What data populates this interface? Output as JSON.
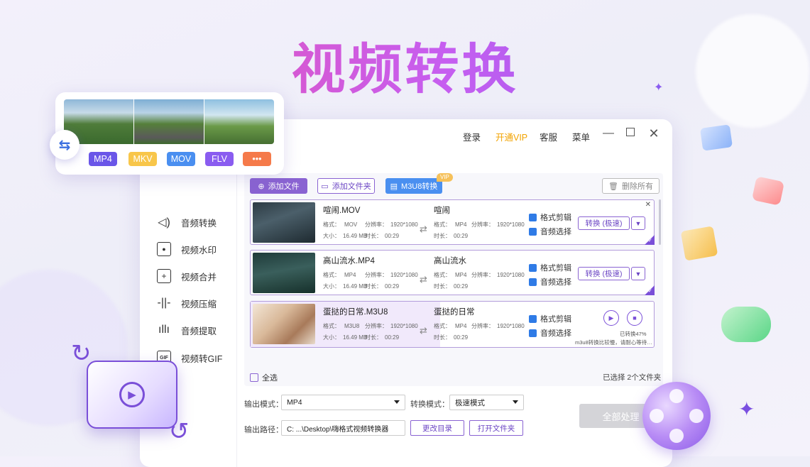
{
  "hero": {
    "title": "视频转换"
  },
  "topbar": {
    "login": "登录",
    "vip": "开通VIP",
    "service": "客服",
    "menu": "菜单"
  },
  "sidebar": {
    "items": [
      {
        "label": "音频转换",
        "icon": "speaker-icon"
      },
      {
        "label": "视频水印",
        "icon": "watermark-icon"
      },
      {
        "label": "视频合并",
        "icon": "merge-icon"
      },
      {
        "label": "视频压缩",
        "icon": "compress-icon"
      },
      {
        "label": "音频提取",
        "icon": "waveform-icon"
      },
      {
        "label": "视频转GIF",
        "icon": "gif-icon"
      }
    ]
  },
  "toolbar": {
    "add_file": "添加文件",
    "add_folder": "添加文件夹",
    "m3u8": "M3U8转换",
    "vip_badge": "VIP",
    "delete_all": "删除所有"
  },
  "files": [
    {
      "src_name": "喧闹.MOV",
      "dst_name": "喧闹",
      "src_format_label": "格式：",
      "src_format": "MOV",
      "src_res_label": "分辨率：",
      "src_res": "1920*1080",
      "src_size_label": "大小：",
      "src_size": "16.49 MB",
      "src_dur_label": "时长：",
      "src_dur": "00:29",
      "dst_format": "MP4",
      "dst_res": "1920*1080",
      "dst_dur": "00:29",
      "edit": "格式剪辑",
      "audio": "音频选择",
      "convert": "转换 (极速)"
    },
    {
      "src_name": "高山流水.MP4",
      "dst_name": "高山流水",
      "src_format_label": "格式：",
      "src_format": "MP4",
      "src_res_label": "分辨率：",
      "src_res": "1920*1080",
      "src_size_label": "大小：",
      "src_size": "16.49 MB",
      "src_dur_label": "时长：",
      "src_dur": "00:29",
      "dst_format": "MP4",
      "dst_res": "1920*1080",
      "dst_dur": "00:29",
      "edit": "格式剪辑",
      "audio": "音频选择",
      "convert": "转换 (极速)"
    },
    {
      "src_name": "蛋挞的日常.M3U8",
      "dst_name": "蛋挞的日常",
      "src_format_label": "格式：",
      "src_format": "M3U8",
      "src_res_label": "分辨率：",
      "src_res": "1920*1080",
      "src_size_label": "大小：",
      "src_size": "16.49 MB",
      "src_dur_label": "时长：",
      "src_dur": "00:29",
      "dst_format": "MP4",
      "dst_res": "1920*1080",
      "dst_dur": "00:29",
      "edit": "格式剪辑",
      "audio": "音频选择",
      "progress_text": "已转换47%",
      "progress": 0.47,
      "hint": "m3u8转换比较慢，请耐心等待…"
    }
  ],
  "footer": {
    "select_all": "全选",
    "selected": "已选择 2个文件夹",
    "output_mode_label": "输出模式：",
    "output_mode": "MP4",
    "convert_mode_label": "转换模式：",
    "convert_mode": "极速模式",
    "output_path_label": "输出路径：",
    "output_path": "C: ...\\Desktop\\嗨格式视频转换器",
    "change_dir": "更改目录",
    "open_folder": "打开文件夹",
    "process_all": "全部处理"
  },
  "formats": [
    "MP4",
    "MKV",
    "MOV",
    "FLV",
    "•••"
  ],
  "format_colors": [
    "#6a56e8",
    "#f8c64a",
    "#4a8ff0",
    "#8a5cf0",
    "#f57a4a"
  ],
  "colors": {
    "accent": "#7a4fd8",
    "vip": "#f2a300",
    "blue": "#2f7be6"
  }
}
